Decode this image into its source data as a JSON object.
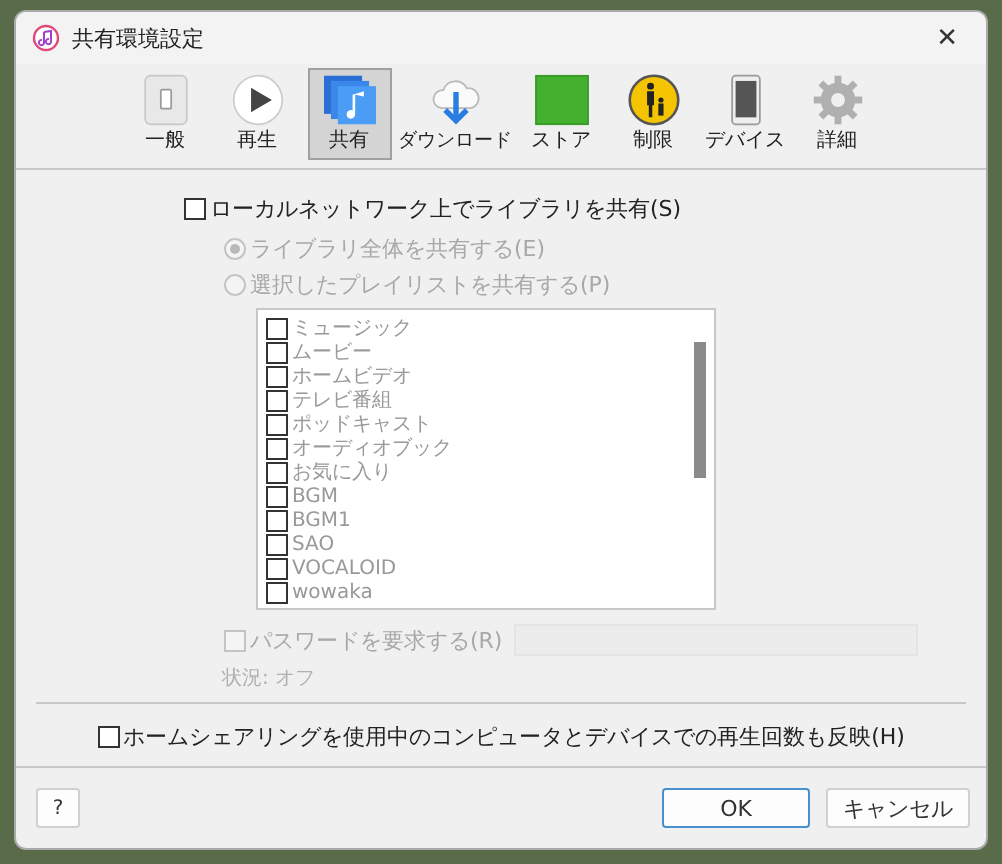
{
  "window": {
    "title": "共有環境設定",
    "close": "✕"
  },
  "tabs": [
    {
      "label": "一般",
      "kind": "general",
      "selected": false
    },
    {
      "label": "再生",
      "kind": "playback",
      "selected": false
    },
    {
      "label": "共有",
      "kind": "sharing",
      "selected": true
    },
    {
      "label": "ダウンロード",
      "kind": "downloads",
      "selected": false
    },
    {
      "label": "ストア",
      "kind": "store",
      "selected": false
    },
    {
      "label": "制限",
      "kind": "restrictions",
      "selected": false
    },
    {
      "label": "デバイス",
      "kind": "devices",
      "selected": false
    },
    {
      "label": "詳細",
      "kind": "advanced",
      "selected": false
    }
  ],
  "share_library": {
    "label": "ローカルネットワーク上でライブラリを共有(S)",
    "checked": false
  },
  "share_options": [
    {
      "label": "ライブラリ全体を共有する(E)",
      "selected": true,
      "disabled": true
    },
    {
      "label": "選択したプレイリストを共有する(P)",
      "selected": false,
      "disabled": true
    }
  ],
  "playlists": [
    {
      "label": "ミュージック",
      "checked": false
    },
    {
      "label": "ムービー",
      "checked": false
    },
    {
      "label": "ホームビデオ",
      "checked": false
    },
    {
      "label": "テレビ番組",
      "checked": false
    },
    {
      "label": "ポッドキャスト",
      "checked": false
    },
    {
      "label": "オーディオブック",
      "checked": false
    },
    {
      "label": "お気に入り",
      "checked": false
    },
    {
      "label": "BGM",
      "checked": false
    },
    {
      "label": "BGM1",
      "checked": false
    },
    {
      "label": "SAO",
      "checked": false
    },
    {
      "label": "VOCALOID",
      "checked": false
    },
    {
      "label": "wowaka",
      "checked": false
    }
  ],
  "require_password": {
    "label": "パスワードを要求する(R)",
    "checked": false,
    "disabled": true
  },
  "status": "状況: オフ",
  "home_sharing": {
    "label": "ホームシェアリングを使用中のコンピュータとデバイスでの再生回数も反映(H)",
    "checked": false
  },
  "buttons": {
    "help": "?",
    "ok": "OK",
    "cancel": "キャンセル"
  }
}
